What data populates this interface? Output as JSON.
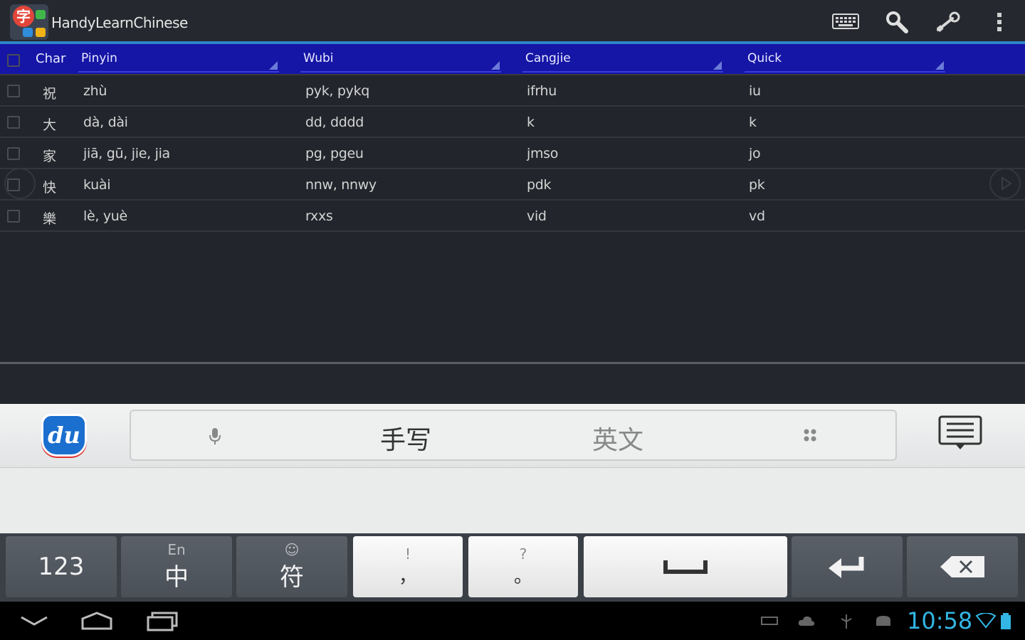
{
  "app": {
    "title": "HandyLearnChinese",
    "icon_name": "app-logo-icon"
  },
  "actionbar": {
    "icons": [
      "keyboard-icon",
      "search-icon",
      "settings-tools-icon",
      "overflow-menu-icon"
    ]
  },
  "table": {
    "headers": {
      "char": "Char",
      "pinyin": "Pinyin",
      "wubi": "Wubi",
      "cangjie": "Cangjie",
      "quick": "Quick"
    },
    "rows": [
      {
        "char": "祝",
        "pinyin": "zhù",
        "wubi": "pyk, pykq",
        "cangjie": "ifrhu",
        "quick": "iu"
      },
      {
        "char": "大",
        "pinyin": "dà, dài",
        "wubi": "dd, dddd",
        "cangjie": "k",
        "quick": "k"
      },
      {
        "char": "家",
        "pinyin": "jiā, gū, jie, jia",
        "wubi": "pg, pgeu",
        "cangjie": "jmso",
        "quick": "jo"
      },
      {
        "char": "快",
        "pinyin": "kuài",
        "wubi": "nnw, nnwy",
        "cangjie": "pdk",
        "quick": "pk"
      },
      {
        "char": "樂",
        "pinyin": "lè, yuè",
        "wubi": "rxxs",
        "cangjie": "vid",
        "quick": "vd"
      }
    ]
  },
  "ime": {
    "logo_text": "du",
    "tab_handwrite": "手写",
    "tab_english": "英文",
    "keys": {
      "numbers": "123",
      "lang_sup": "En",
      "lang_main": "中",
      "symbol_sup": "☺",
      "symbol_main": "符",
      "comma_sup": "!",
      "comma_main": "，",
      "period_sup": "?",
      "period_main": "。"
    }
  },
  "statusbar": {
    "time": "10:58"
  },
  "colors": {
    "header_bg": "#1515a6",
    "accent_blue": "#2f84c8",
    "clock": "#33b5e5",
    "app_bg": "#22252b"
  }
}
